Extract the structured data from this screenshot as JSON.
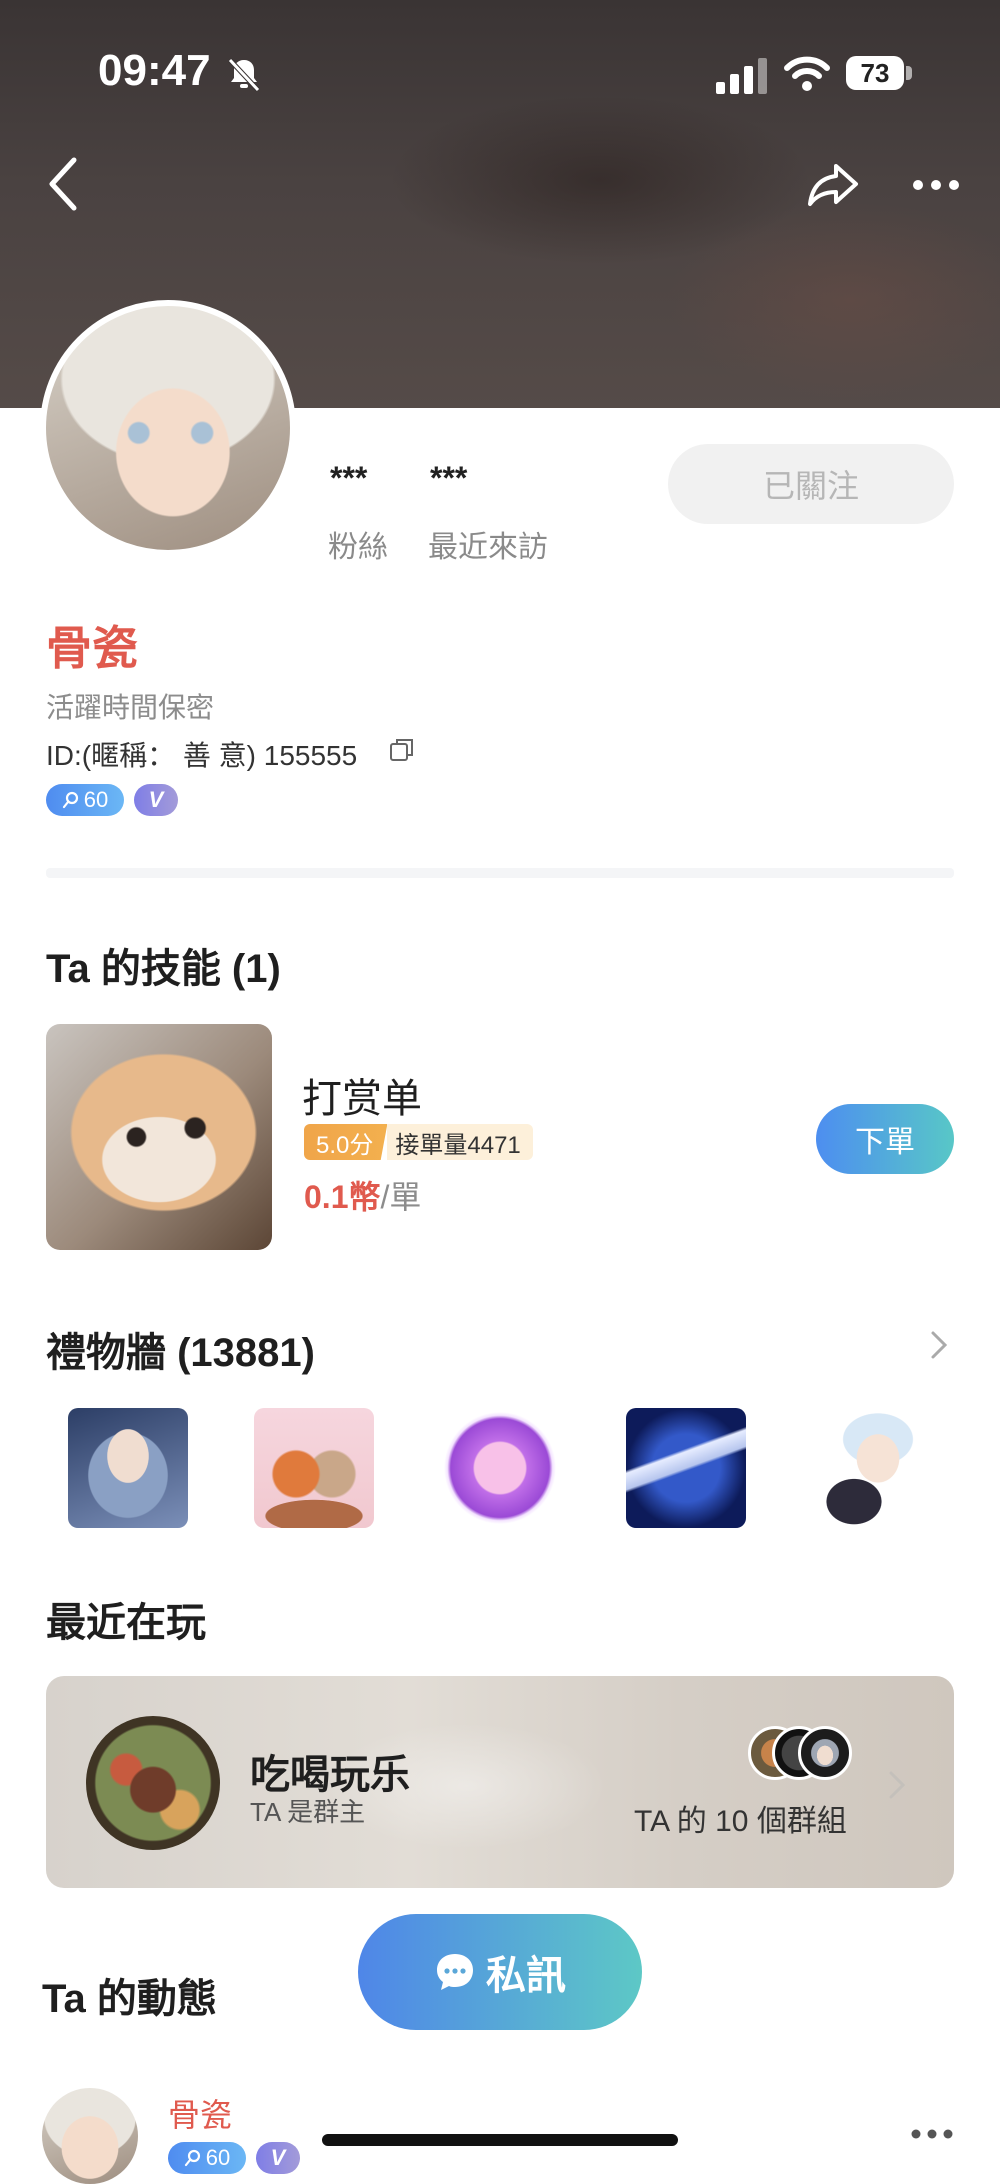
{
  "status_bar": {
    "time": "09:47",
    "battery": "73"
  },
  "profile": {
    "fans_value": "***",
    "fans_label": "粉絲",
    "visits_value": "***",
    "visits_label": "最近來訪",
    "follow_label": "已關注",
    "nickname": "骨瓷",
    "active_text": "活躍時間保密",
    "id_text": "ID:(暱稱： 善 意) 155555",
    "level": "60",
    "v_label": "V"
  },
  "skills": {
    "title": "Ta 的技能 (1)",
    "item": {
      "name": "打赏单",
      "score": "5.0分",
      "orders": "接單量4471",
      "price": "0.1幣",
      "unit": "/單",
      "order_button": "下單"
    }
  },
  "gifts": {
    "title": "禮物牆 (13881)",
    "items": [
      "gift-portrait",
      "gift-fox-couple",
      "gift-purple-box",
      "gift-rocket",
      "gift-doll"
    ]
  },
  "recent_play": {
    "title": "最近在玩",
    "game": "吃喝玩乐",
    "role": "TA 是群主",
    "groups": "TA 的 10 個群組"
  },
  "feed": {
    "title": "Ta 的動態",
    "post_name": "骨瓷",
    "post_level": "60",
    "post_v": "V"
  },
  "dm_button": "私訊",
  "colors": {
    "accent_red": "#e05a4e",
    "gradient_start": "#4f86e8",
    "gradient_end": "#5dc8c6"
  }
}
